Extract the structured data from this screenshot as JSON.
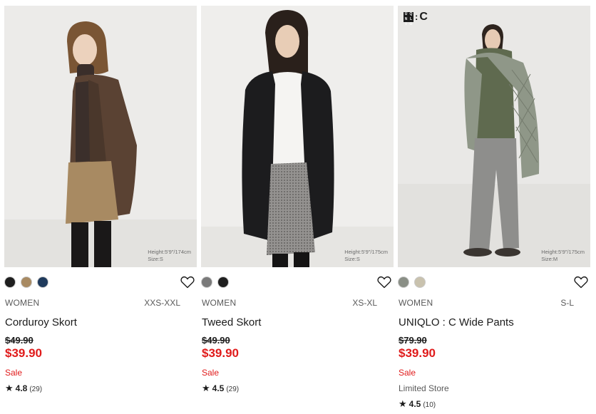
{
  "products": [
    {
      "photo_caption": [
        "Height:5'9\"/174cm",
        "Size:S"
      ],
      "swatches": [
        "#1f1f1f",
        "#a88a62",
        "#1f3a5c"
      ],
      "gender": "WOMEN",
      "sizes": "XXS-XXL",
      "name": "Corduroy Skort",
      "old_price": "$49.90",
      "price": "$39.90",
      "flag": "Sale",
      "rating": "4.8",
      "reviews": "(29)"
    },
    {
      "photo_caption": [
        "Height:5'9\"/175cm",
        "Size:S"
      ],
      "swatches": [
        "#7a7a7a",
        "#1f1f1f"
      ],
      "gender": "WOMEN",
      "sizes": "XS-XL",
      "name": "Tweed Skort",
      "old_price": "$49.90",
      "price": "$39.90",
      "flag": "Sale",
      "rating": "4.5",
      "reviews": "(29)"
    },
    {
      "brand_logo_letters": [
        "U",
        "N",
        "I",
        "Q",
        "L",
        "O",
        ":",
        "C"
      ],
      "photo_caption": [
        "Height:5'9\"/175cm",
        "Size:M"
      ],
      "swatches": [
        "#8a8f86",
        "#c9c2ae"
      ],
      "gender": "WOMEN",
      "sizes": "S-L",
      "name": "UNIQLO : C Wide Pants",
      "old_price": "$79.90",
      "price": "$39.90",
      "flag": "Sale",
      "store_note": "Limited Store",
      "rating": "4.5",
      "reviews": "(10)"
    }
  ],
  "icons": {
    "favorite": "heart-outline-icon",
    "rating": "star-icon"
  },
  "colors": {
    "sale_red": "#e01b1b",
    "text": "#1b1b1b",
    "muted": "#5a5a5a"
  }
}
